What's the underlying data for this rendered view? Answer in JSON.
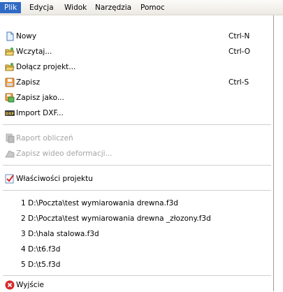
{
  "menubar": {
    "items": [
      {
        "label": "Plik"
      },
      {
        "label": "Edycja"
      },
      {
        "label": "Widok"
      },
      {
        "label": "Narzędzia"
      },
      {
        "label": "Pomoc"
      }
    ]
  },
  "file_menu": {
    "commands": [
      {
        "label": "Nowy",
        "shortcut": "Ctrl-N",
        "icon": "new-document-icon",
        "enabled": true
      },
      {
        "label": "Wczytaj...",
        "shortcut": "Ctrl-O",
        "icon": "open-folder-icon",
        "enabled": true
      },
      {
        "label": "Dołącz projekt...",
        "shortcut": "",
        "icon": "attach-folder-icon",
        "enabled": true
      },
      {
        "label": "Zapisz",
        "shortcut": "Ctrl-S",
        "icon": "save-disk-icon",
        "enabled": true
      },
      {
        "label": "Zapisz jako...",
        "shortcut": "",
        "icon": "save-as-icon",
        "enabled": true
      },
      {
        "label": "Import DXF...",
        "shortcut": "",
        "icon": "dxf-icon",
        "enabled": true
      }
    ],
    "disabled_commands": [
      {
        "label": "Raport obliczeń",
        "icon": "report-icon",
        "enabled": false
      },
      {
        "label": "Zapisz wideo deformacji...",
        "icon": "video-icon",
        "enabled": false
      }
    ],
    "properties": {
      "label": "Właściwości projektu",
      "icon": "checklist-icon"
    },
    "recent_files": [
      "1 D:\\Poczta\\test wymiarowania drewna.f3d",
      "2 D:\\Poczta\\test wymiarowania drewna _złozony.f3d",
      "3 D:\\hala stalowa.f3d",
      "4 D:\\t6.f3d",
      "5 D:\\t5.f3d"
    ],
    "exit": {
      "label": "Wyjście",
      "icon": "exit-icon"
    }
  },
  "colors": {
    "menubar_active_bg": "#316ac5",
    "disabled_text": "#a4a4a4",
    "exit_icon": "#d62a2a"
  }
}
